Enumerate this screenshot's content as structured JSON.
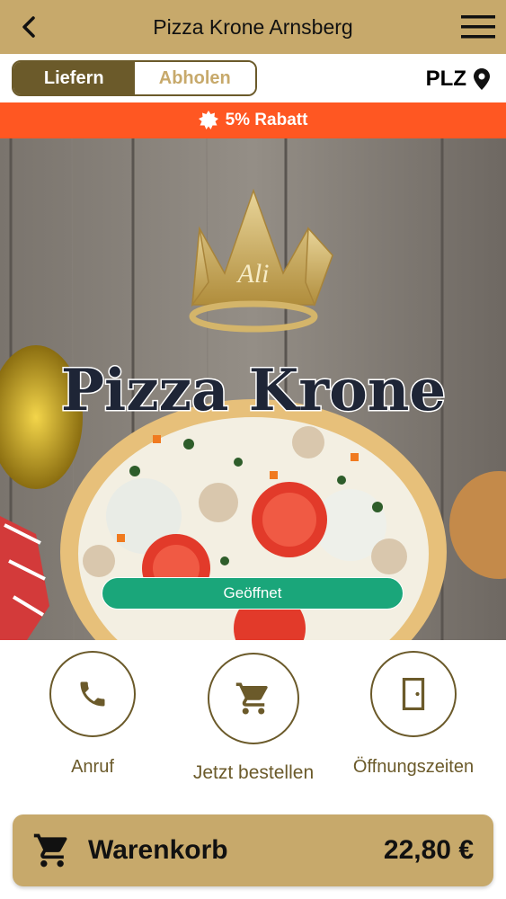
{
  "header": {
    "title": "Pizza Krone Arnsberg",
    "back_icon": "chevron-left-icon",
    "menu_icon": "hamburger-menu-icon"
  },
  "delivery_toggle": {
    "options": [
      {
        "label": "Liefern",
        "active": true
      },
      {
        "label": "Abholen",
        "active": false
      }
    ]
  },
  "plz": {
    "label": "PLZ",
    "icon": "location-pin-icon"
  },
  "discount": {
    "text": "5% Rabatt",
    "icon": "badge-star-icon",
    "color": "#ff5722"
  },
  "hero": {
    "logo_text": "Pizza Krone",
    "crown_text": "Ali",
    "status": "Geöffnet",
    "status_color": "#1aa67a"
  },
  "actions": [
    {
      "label": "Anruf",
      "icon": "phone-icon"
    },
    {
      "label": "Jetzt bestellen",
      "icon": "cart-icon"
    },
    {
      "label": "Öffnungszeiten",
      "icon": "door-icon"
    }
  ],
  "cart": {
    "label": "Warenkorb",
    "total": "22,80 €",
    "icon": "cart-icon"
  },
  "colors": {
    "brand_gold": "#c7a96b",
    "brand_dark": "#6b5a2a"
  }
}
